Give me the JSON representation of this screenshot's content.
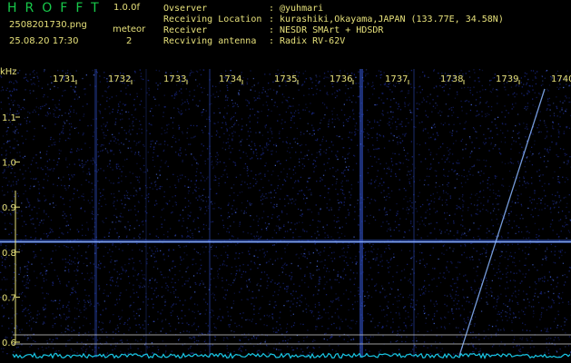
{
  "header": {
    "brand": "HROFFT",
    "version": "1.0.0f",
    "filename": "2508201730.png",
    "datetime": "25.08.20 17:30",
    "meteor_label": "meteor",
    "meteor_count": "2",
    "info": [
      {
        "label": "Ovserver",
        "value": "@yuhmari"
      },
      {
        "label": "Receiving Location",
        "value": "kurashiki,Okayama,JAPAN (133.77E, 34.58N)"
      },
      {
        "label": "Receiver",
        "value": "NESDR SMArt + HDSDR"
      },
      {
        "label": "Recviving antenna",
        "value": "Radix RV-62V"
      }
    ]
  },
  "plot": {
    "unit_label": "kHz",
    "time_labels": [
      "1731",
      "1732",
      "1733",
      "1734",
      "1735",
      "1736",
      "1737",
      "1738",
      "1739",
      "1740"
    ],
    "freq_labels": [
      "1.1",
      "1.0",
      "0.9",
      "0.8",
      "0.7",
      "0.6"
    ],
    "colors": {
      "background": "#000000",
      "noise": "#1b2a8c",
      "signal": "#7fb0ff",
      "baseline": "#19c8e6",
      "label": "#e6e07a"
    }
  }
}
